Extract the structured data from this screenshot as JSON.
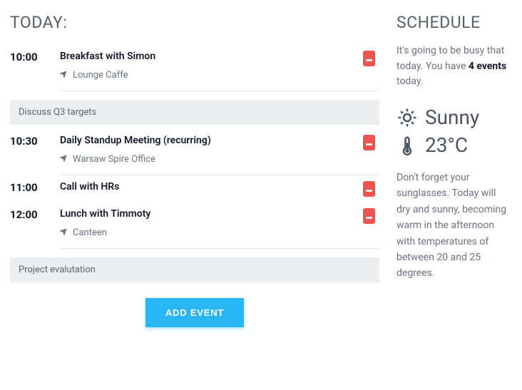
{
  "main": {
    "title": "TODAY:",
    "events": [
      {
        "time": "10:00",
        "title": "Breakfast with Simon",
        "location": "Lounge Caffe",
        "note": "Discuss Q3 targets"
      },
      {
        "time": "10:30",
        "title": "Daily Standup Meeting (recurring)",
        "location": "Warsaw Spire Office",
        "note": null
      },
      {
        "time": "11:00",
        "title": "Call with HRs",
        "location": null,
        "note": null
      },
      {
        "time": "12:00",
        "title": "Lunch with Timmoty",
        "location": "Canteen",
        "note": "Project evalutation"
      }
    ],
    "add_button": "ADD EVENT"
  },
  "aside": {
    "title": "SCHEDULE",
    "subtitle_pre": "It's going to be busy that today. You have ",
    "subtitle_bold": "4 events",
    "subtitle_post": " today.",
    "weather_condition": "Sunny",
    "weather_temp": "23°C",
    "forecast": "Don't forget your sunglasses. Today will dry and sunny, becoming warm in the afternoon with temperatures of between 20 and 25 degrees."
  }
}
